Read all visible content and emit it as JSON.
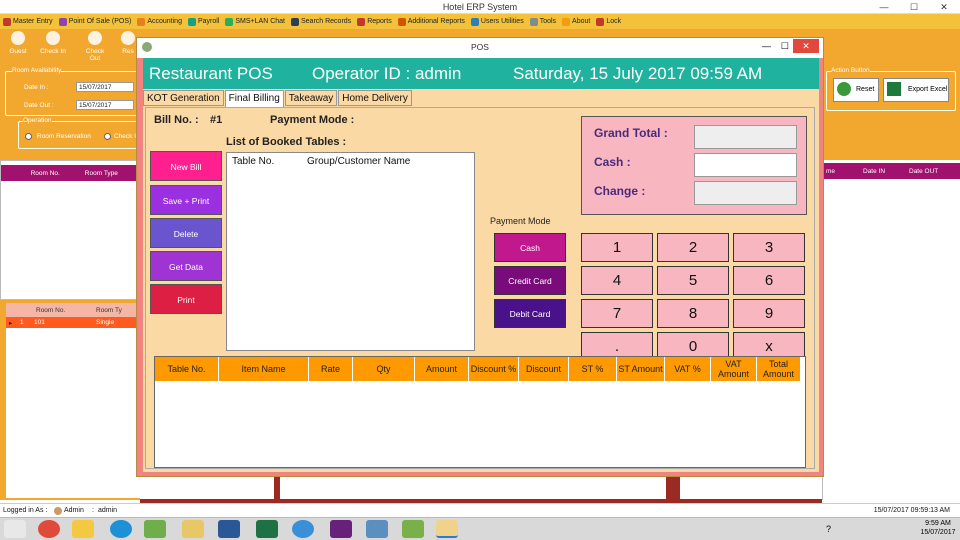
{
  "window": {
    "title": "Hotel ERP System",
    "min": "—",
    "max": "☐",
    "close": "✕"
  },
  "menu": [
    {
      "label": "Master Entry",
      "color": "#c0392b"
    },
    {
      "label": "Point Of Sale (POS)",
      "color": "#8e44ad"
    },
    {
      "label": "Accounting",
      "color": "#e67e22"
    },
    {
      "label": "Payroll",
      "color": "#16a085"
    },
    {
      "label": "SMS+LAN Chat",
      "color": "#27ae60"
    },
    {
      "label": "Search Records",
      "color": "#2c3e50"
    },
    {
      "label": "Reports",
      "color": "#c0392b"
    },
    {
      "label": "Additional Reports",
      "color": "#d35400"
    },
    {
      "label": "Users Utilities",
      "color": "#2980b9"
    },
    {
      "label": "Tools",
      "color": "#7f8c8d"
    },
    {
      "label": "About",
      "color": "#f39c12"
    },
    {
      "label": "Lock",
      "color": "#c0392b"
    }
  ],
  "toolbar": [
    "Guest",
    "Check In",
    "Check Out",
    "Res"
  ],
  "left": {
    "room_availability": "Room Availability",
    "date_in_label": "Date In :",
    "date_in": "15/07/2017",
    "date_out_label": "Date Out :",
    "date_out": "15/07/2017",
    "operation": "Operation",
    "radio1": "Room Reservation",
    "radio2": "Check I",
    "grid1_cols": [
      "Room No.",
      "Room Type"
    ],
    "grid2_cols": [
      "Room No.",
      "Room Ty"
    ],
    "grid2_row": [
      "1",
      "101",
      "Single"
    ]
  },
  "right": {
    "action_button": "Action Button",
    "reset": "Reset",
    "export": "Export Excel",
    "cols": [
      "me",
      "Date IN",
      "Date OUT"
    ]
  },
  "pos": {
    "title": "POS",
    "header_left": "Restaurant POS",
    "header_operator": "Operator ID :  admin",
    "header_date": "Saturday, 15 July 2017 09:59 AM",
    "tabs": [
      "KOT Generation",
      "Final Billing",
      "Takeaway",
      "Home Delivery"
    ],
    "bill_no_label": "Bill No. :",
    "bill_no": "#1",
    "payment_mode_label": "Payment Mode :",
    "booked_tables_label": "List of Booked Tables :",
    "booked_col1": "Table No.",
    "booked_col2": "Group/Customer Name",
    "buttons": [
      "New Bill",
      "Save + Print",
      "Delete",
      "Get Data",
      "Print"
    ],
    "payment_mode_title": "Payment Mode",
    "pay_buttons": [
      "Cash",
      "Credit Card",
      "Debit Card"
    ],
    "grand_total": "Grand Total :",
    "cash": "Cash :",
    "change": "Change :",
    "keys": [
      "1",
      "2",
      "3",
      "4",
      "5",
      "6",
      "7",
      "8",
      "9",
      ".",
      "0",
      "x"
    ],
    "table_cols": [
      "Table No.",
      "Item Name",
      "Rate",
      "Qty",
      "Amount",
      "Discount %",
      "Discount",
      "ST %",
      "ST Amount",
      "VAT %",
      "VAT Amount",
      "Total Amount"
    ]
  },
  "status": {
    "logged": "Logged in As :",
    "user": "Admin",
    "sep": ":",
    "role": "admin",
    "datetime": "15/07/2017 09:59:13 AM"
  },
  "tray": {
    "time": "9:59 AM",
    "date": "15/07/2017"
  }
}
